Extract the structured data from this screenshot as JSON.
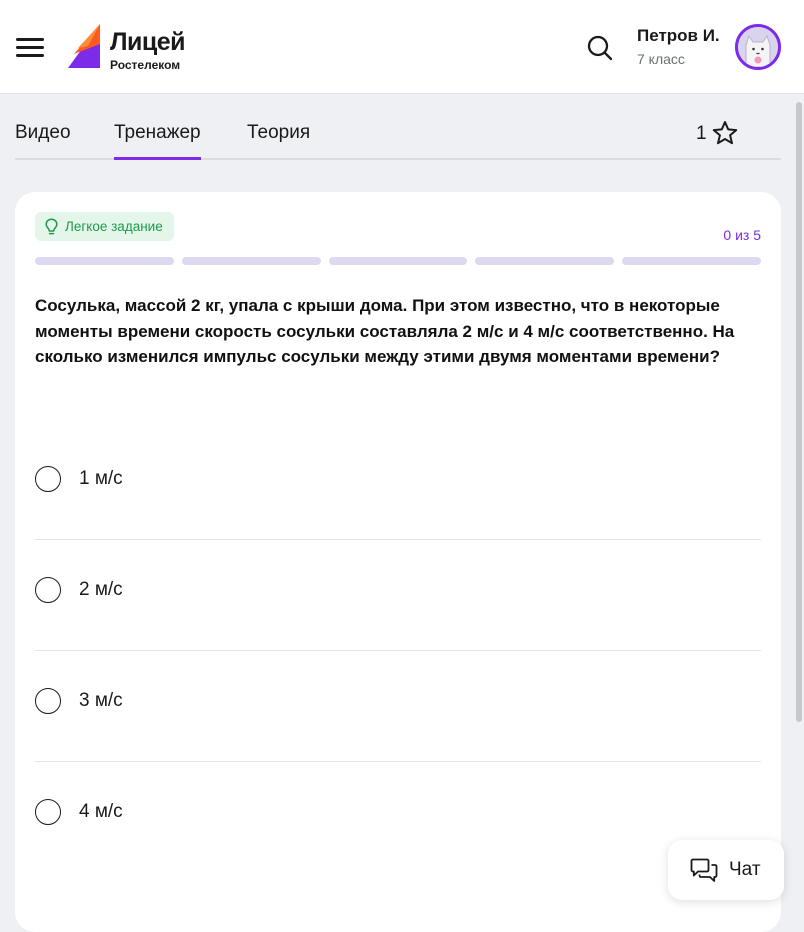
{
  "header": {
    "logo_title": "Лицей",
    "logo_subtitle": "Ростелеком",
    "user_name": "Петров И.",
    "user_class": "7 класс"
  },
  "tabs": [
    {
      "label": "Видео",
      "active": false
    },
    {
      "label": "Тренажер",
      "active": true
    },
    {
      "label": "Теория",
      "active": false
    }
  ],
  "rating": {
    "count": "1"
  },
  "task": {
    "difficulty": "Легкое задание",
    "progress_text": "0 из 5",
    "progress_total": 5,
    "progress_done": 0,
    "question": "Сосулька, массой 2 кг, упала с крыши дома. При этом известно, что в некоторые моменты времени скорость сосульки составляла 2 м/с и 4 м/с соответственно. На сколько изменился импульс сосульки между этими двумя моментами времени?",
    "options": [
      {
        "label": "1 м/с",
        "selected": false
      },
      {
        "label": "2 м/с",
        "selected": false
      },
      {
        "label": "3 м/с",
        "selected": false
      },
      {
        "label": "4 м/с",
        "selected": false
      }
    ]
  },
  "chat": {
    "label": "Чат"
  },
  "colors": {
    "accent": "#7c2be8",
    "difficulty_bg": "#e4f6ea",
    "difficulty_text": "#1f9a4c",
    "progress_empty": "#dfd8f3",
    "page_bg": "#eef0f4"
  },
  "icons": {
    "menu": "hamburger-icon",
    "search": "search-icon",
    "star": "star-outline-icon",
    "difficulty": "lightbulb-icon",
    "chat": "chat-bubbles-icon"
  }
}
